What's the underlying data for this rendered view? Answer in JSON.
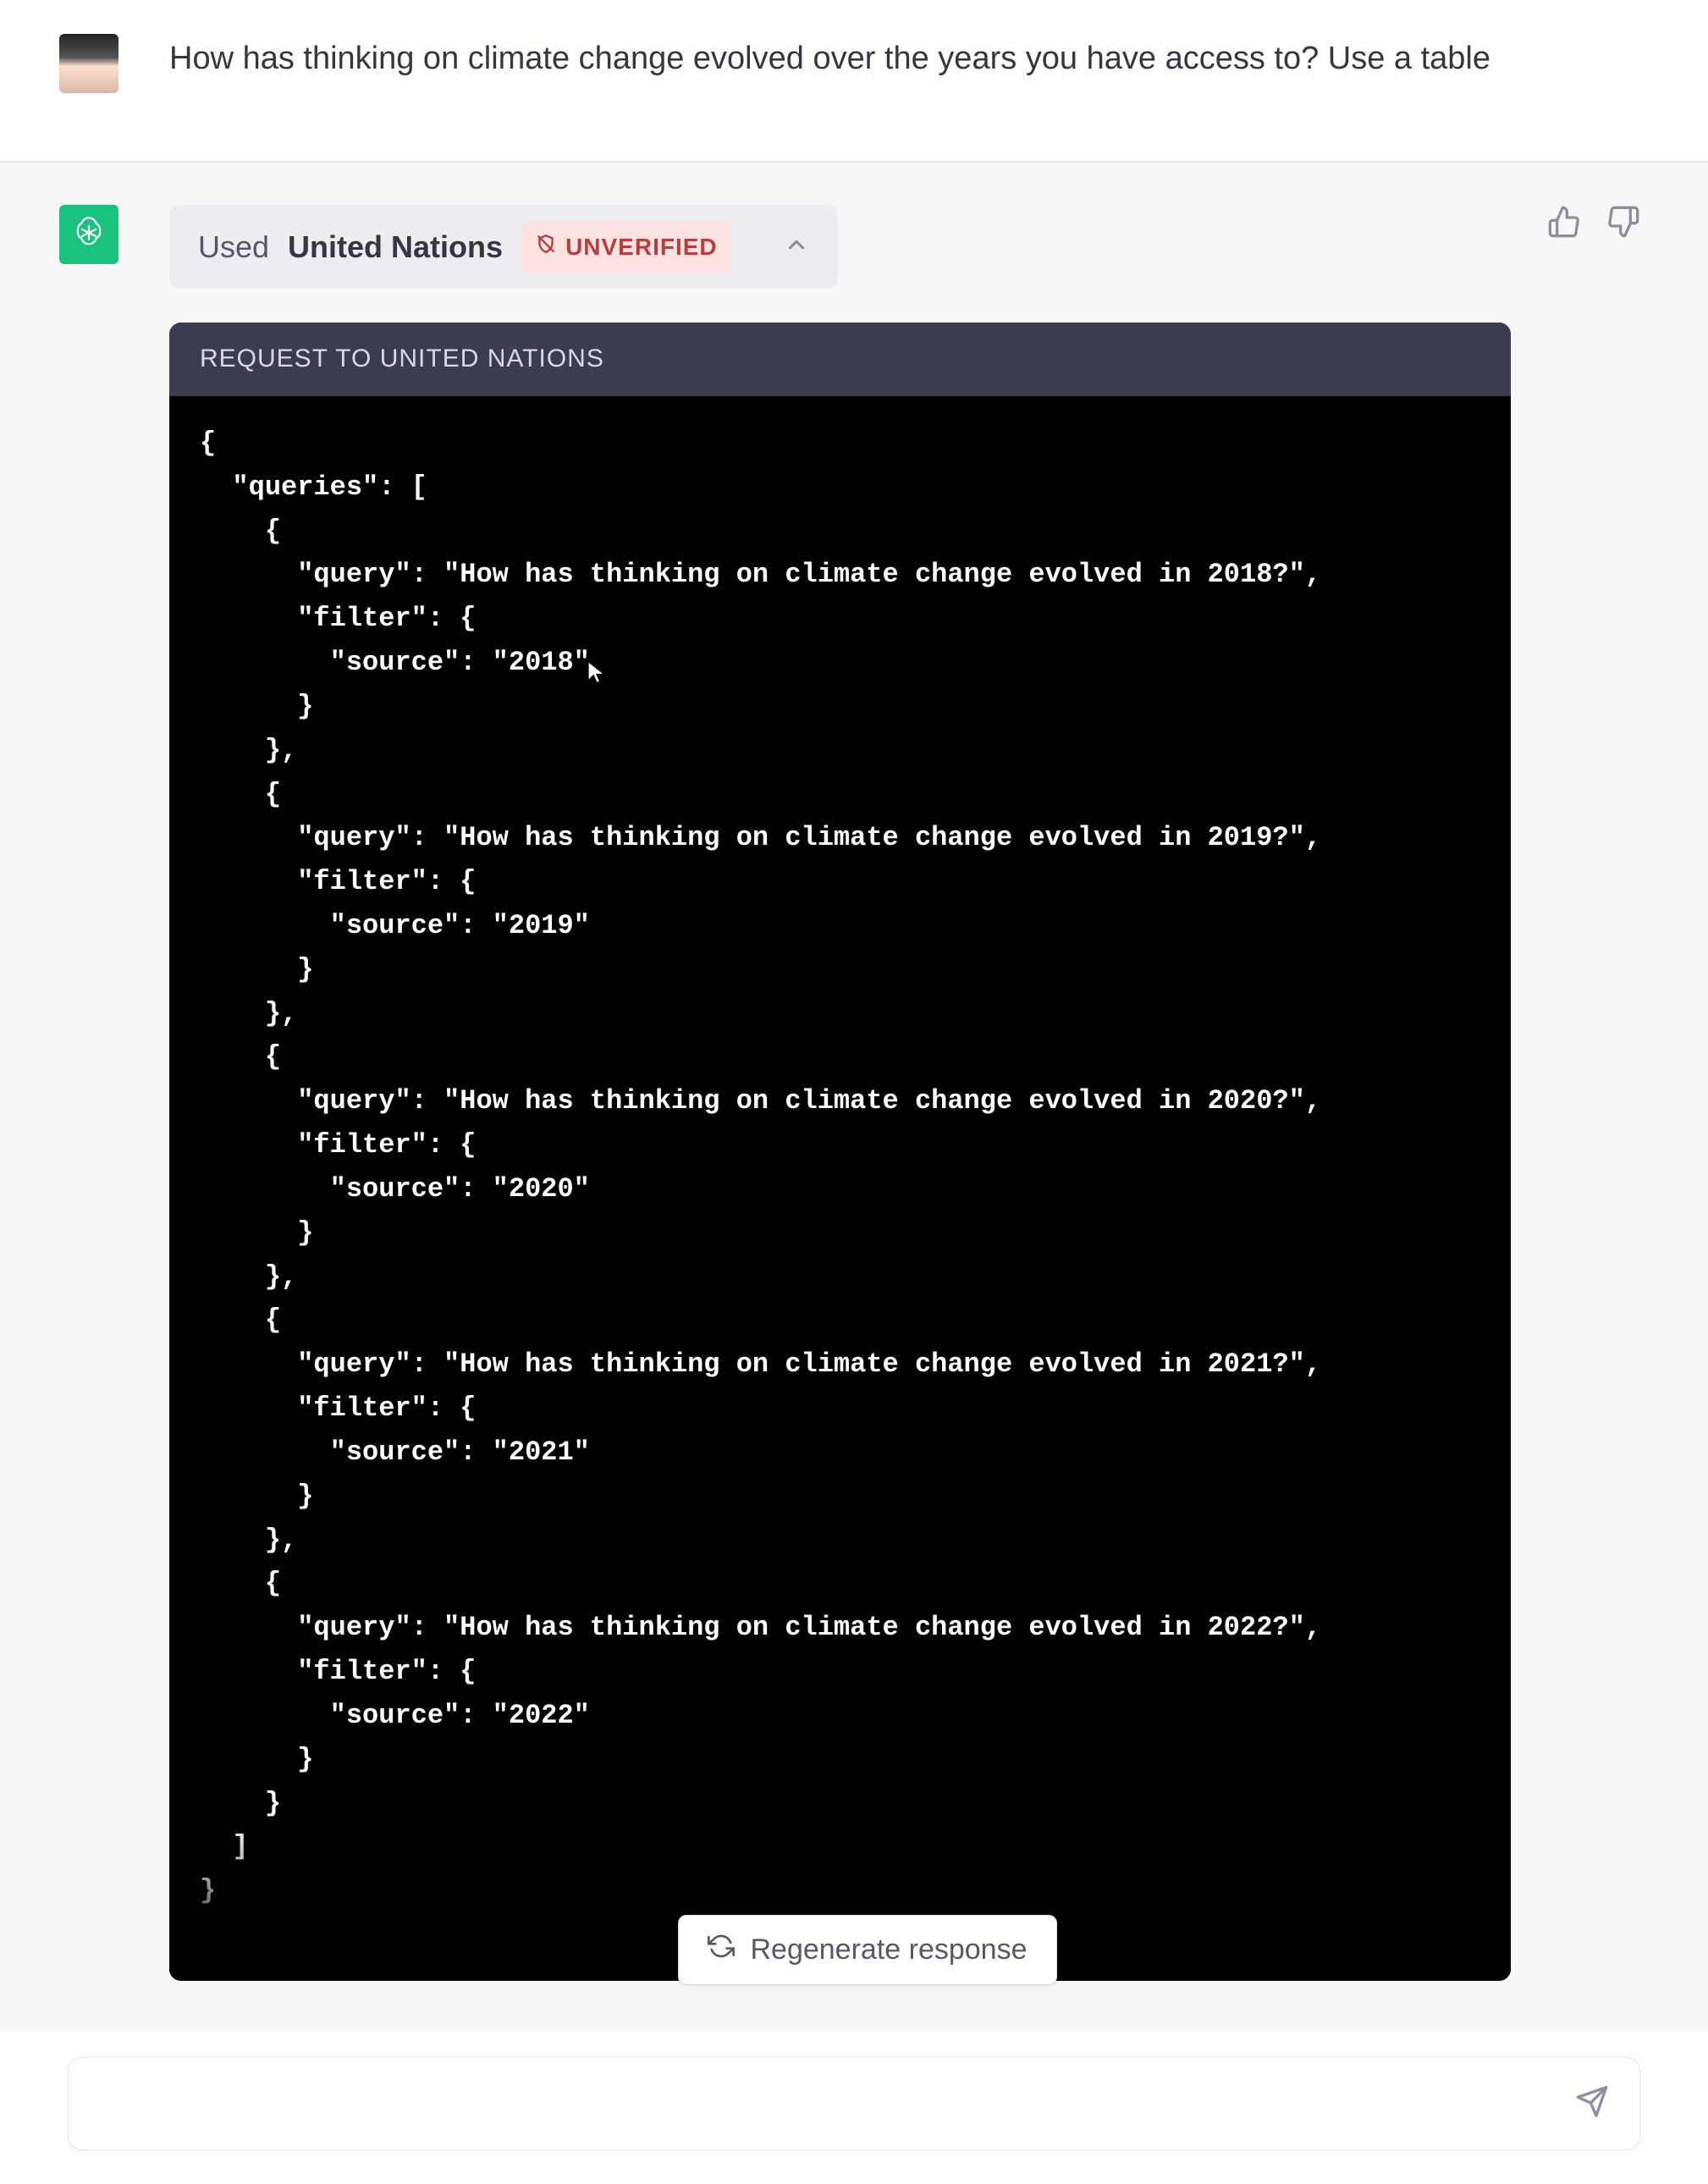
{
  "user_message": "How has thinking on climate change evolved over the years you have access to? Use a table",
  "plugin": {
    "used_prefix": "Used",
    "name": "United Nations",
    "badge": "UNVERIFIED"
  },
  "code": {
    "header": "REQUEST TO UNITED NATIONS",
    "body": "{\n  \"queries\": [\n    {\n      \"query\": \"How has thinking on climate change evolved in 2018?\",\n      \"filter\": {\n        \"source\": \"2018\"\n      }\n    },\n    {\n      \"query\": \"How has thinking on climate change evolved in 2019?\",\n      \"filter\": {\n        \"source\": \"2019\"\n      }\n    },\n    {\n      \"query\": \"How has thinking on climate change evolved in 2020?\",\n      \"filter\": {\n        \"source\": \"2020\"\n      }\n    },\n    {\n      \"query\": \"How has thinking on climate change evolved in 2021?\",\n      \"filter\": {\n        \"source\": \"2021\"\n      }\n    },\n    {\n      \"query\": \"How has thinking on climate change evolved in 2022?\",\n      \"filter\": {\n        \"source\": \"2022\"\n      }\n    }\n  ]\n}"
  },
  "regenerate_label": "Regenerate response",
  "input_placeholder": ""
}
